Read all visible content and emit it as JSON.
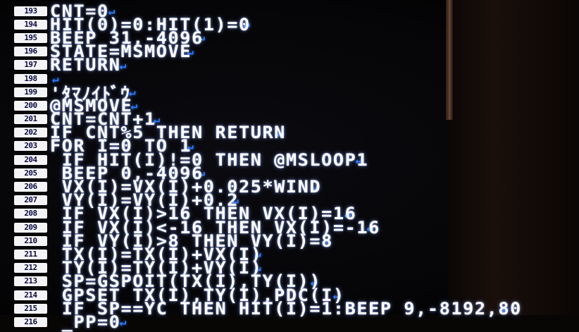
{
  "listing": {
    "lines": [
      {
        "num": "193",
        "text": "CNT=0"
      },
      {
        "num": "194",
        "text": "HIT(0)=0:HIT(1)=0"
      },
      {
        "num": "195",
        "text": "BEEP 31,-4096"
      },
      {
        "num": "196",
        "text": "STATE=MSMOVE"
      },
      {
        "num": "197",
        "text": "RETURN"
      },
      {
        "num": "198",
        "text": ""
      },
      {
        "num": "199",
        "text": "'ﾀﾏﾉｲﾄﾞｳ"
      },
      {
        "num": "200",
        "text": "@MSMOVE"
      },
      {
        "num": "201",
        "text": "CNT=CNT+1"
      },
      {
        "num": "202",
        "text": "IF CNT%5 THEN RETURN"
      },
      {
        "num": "203",
        "text": "FOR I=0 TO 1"
      },
      {
        "num": "204",
        "text": " IF HIT(I)!=0 THEN @MSLOOP1"
      },
      {
        "num": "205",
        "text": " BEEP 0,-4096"
      },
      {
        "num": "206",
        "text": " VX(I)=VX(I)+0.025*WIND"
      },
      {
        "num": "207",
        "text": " VY(I)=VY(I)+0.2"
      },
      {
        "num": "208",
        "text": " IF VX(I)>16 THEN VX(I)=16"
      },
      {
        "num": "209",
        "text": " IF VX(I)<-16 THEN VX(I)=-16"
      },
      {
        "num": "210",
        "text": " IF VY(I)>8 THEN VY(I)=8"
      },
      {
        "num": "211",
        "text": " TX(I)=TX(I)+VX(I)"
      },
      {
        "num": "212",
        "text": " TY(I)=TY(I)+VY(I)"
      },
      {
        "num": "213",
        "text": " SP=GSPOIT(TX(I),TY(I))"
      },
      {
        "num": "214",
        "text": " GPSET TX(I),TY(I),PDC(I)"
      },
      {
        "num": "215",
        "text": " IF SP==YC THEN HIT(I)=1:BEEP 9,-8192,80"
      },
      {
        "num": "216",
        "text": " _PP=0"
      }
    ],
    "return_glyph": "↵",
    "colors": {
      "text": "#ffffff",
      "line_number_bg": "#f4f4f6",
      "line_number_fg": "#0a0a40",
      "return_mark": "#2e7bff",
      "background": "#060608"
    }
  }
}
